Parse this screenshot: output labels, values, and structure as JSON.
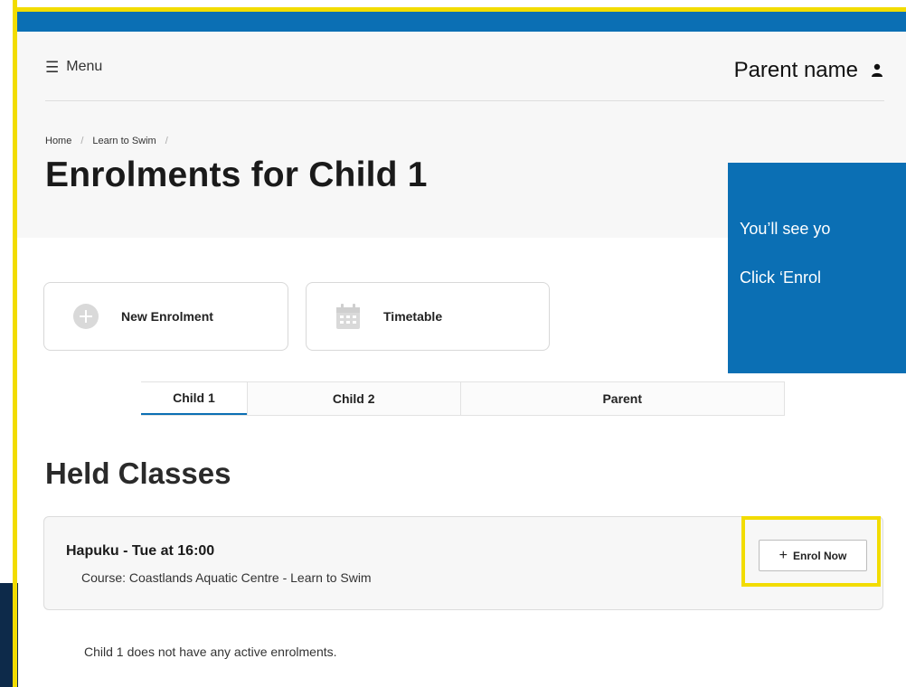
{
  "header": {
    "menu_label": "Menu",
    "menu_icon": "☰",
    "user_name": "Parent name",
    "user_icon": "person-icon"
  },
  "breadcrumb": {
    "items": [
      "Home",
      "Learn to Swim"
    ],
    "separator": "/"
  },
  "page": {
    "title": "Enrolments for Child 1"
  },
  "callout": {
    "line1": "You’ll see yo",
    "line2": "Click ‘Enrol"
  },
  "actions": {
    "new_enrolment": {
      "label": "New Enrolment",
      "icon": "plus-circle-icon"
    },
    "timetable": {
      "label": "Timetable",
      "icon": "calendar-icon"
    }
  },
  "tabs": [
    {
      "label": "Child 1",
      "active": true
    },
    {
      "label": "Child 2",
      "active": false
    },
    {
      "label": "Parent",
      "active": false
    }
  ],
  "held_classes": {
    "title": "Held Classes",
    "items": [
      {
        "name": "Hapuku - Tue at 16:00",
        "course": "Course: Coastlands Aquatic Centre - Learn to Swim",
        "button_label": "Enrol Now",
        "button_icon": "+"
      }
    ]
  },
  "notice": {
    "child": "Child 1",
    "text": "does not have any active enrolments."
  },
  "colors": {
    "brand_blue": "#0b6fb4",
    "highlight_yellow": "#f2dc00",
    "navy": "#0d2a4a"
  }
}
